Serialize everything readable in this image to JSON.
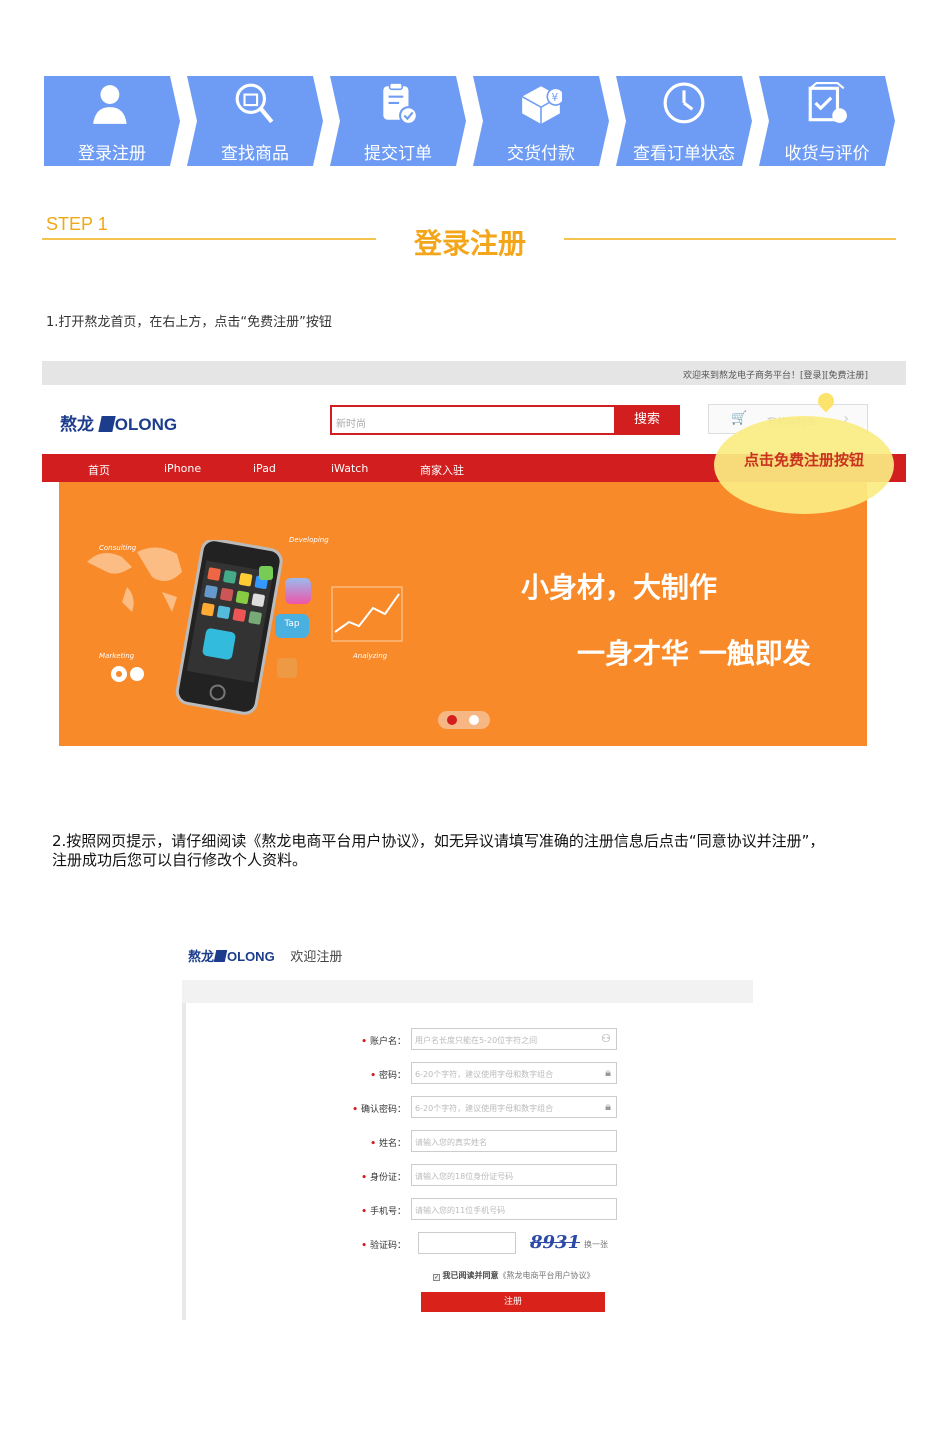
{
  "steps": [
    {
      "label": "登录注册",
      "icon": "user-icon"
    },
    {
      "label": "查找商品",
      "icon": "search-bag-icon"
    },
    {
      "label": "提交订单",
      "icon": "order-clipboard-icon"
    },
    {
      "label": "交货付款",
      "icon": "package-payment-icon"
    },
    {
      "label": "查看订单状态",
      "icon": "clock-icon"
    },
    {
      "label": "收货与评价",
      "icon": "review-box-icon"
    }
  ],
  "section": {
    "step_num": "STEP 1",
    "title": "登录注册"
  },
  "instruction1": "1.打开熬龙首页，在右上方，点击“免费注册”按钮",
  "instruction2_line1": "2.按照网页提示，请仔细阅读《熬龙电商平台用户协议》，如无异议请填写准确的注册信息后点击“同意协议并注册”，",
  "instruction2_line2": "注册成功后您可以自行修改个人资料。",
  "homepage": {
    "topbar_text": "欢迎来到熬龙电子商务平台！[登录][免费注册]",
    "logo_cn": "熬龙",
    "logo_en": "OLONG",
    "search_placeholder": "新时尚",
    "search_button": "搜索",
    "cart_label": "我的购物车",
    "nav": [
      "首页",
      "iPhone",
      "iPad",
      "iWatch",
      "商家入驻"
    ],
    "callout": "点击免费注册按钮",
    "banner_line1": "小身材，大制作",
    "banner_line2": "一身才华 一触即发",
    "banner_tags": [
      "Consulting",
      "Developing",
      "Marketing",
      "Analyzing"
    ]
  },
  "register": {
    "logo_cn": "熬龙",
    "logo_en": "OLONG",
    "heading": "欢迎注册",
    "fields": [
      {
        "label": "账户名：",
        "placeholder": "用户名长度只能在5-20位字符之间",
        "icon": "user-icon"
      },
      {
        "label": "密码：",
        "placeholder": "6-20个字符，建议使用字母和数字组合",
        "icon": "lock-icon"
      },
      {
        "label": "确认密码：",
        "placeholder": "6-20个字符，建议使用字母和数字组合",
        "icon": "lock-icon"
      },
      {
        "label": "姓名：",
        "placeholder": "请输入您的真实姓名",
        "icon": ""
      },
      {
        "label": "身份证：",
        "placeholder": "请输入您的18位身份证号码",
        "icon": ""
      },
      {
        "label": "手机号：",
        "placeholder": "请输入您的11位手机号码",
        "icon": ""
      }
    ],
    "captcha_label": "验证码：",
    "captcha_text": "8931",
    "captcha_refresh": "换一张",
    "agree_text": "我已阅读并同意",
    "agree_link": "《熬龙电商平台用户协议》",
    "submit": "注册"
  },
  "colors": {
    "step_blue": "#6e9cf4",
    "gold": "#f4a61b",
    "red": "#d21e1e",
    "banner_orange": "#f88a2a"
  }
}
